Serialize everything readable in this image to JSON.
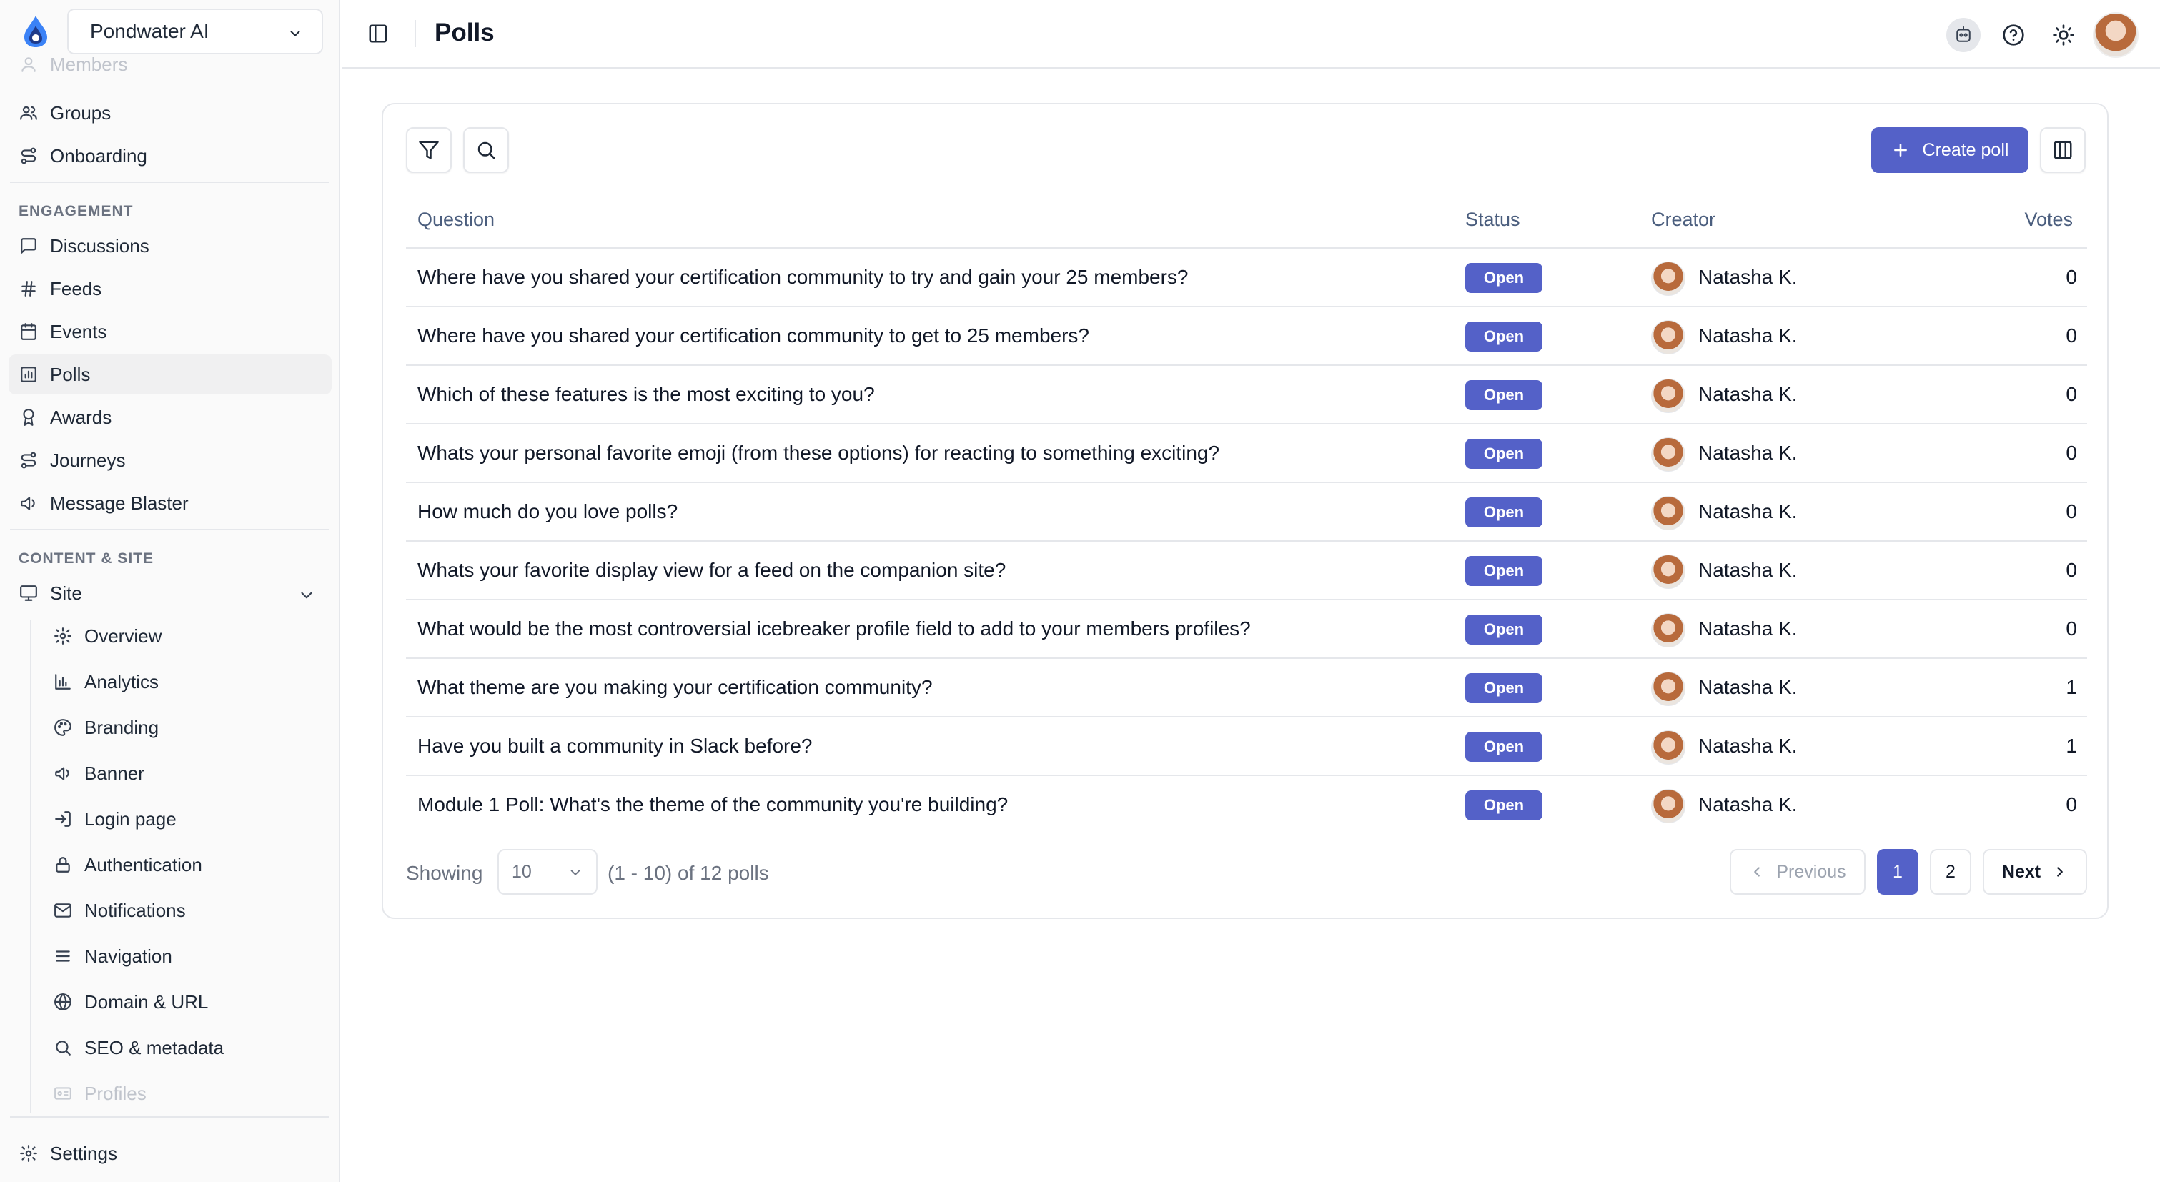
{
  "workspace": {
    "name": "Pondwater AI"
  },
  "sidebar": {
    "top_items": [
      {
        "label": "Members",
        "icon": "user-icon"
      },
      {
        "label": "Groups",
        "icon": "users-icon"
      },
      {
        "label": "Onboarding",
        "icon": "route-icon"
      }
    ],
    "engagement_label": "ENGAGEMENT",
    "engagement_items": [
      {
        "label": "Discussions",
        "icon": "message-square-icon"
      },
      {
        "label": "Feeds",
        "icon": "hash-icon"
      },
      {
        "label": "Events",
        "icon": "calendar-icon"
      },
      {
        "label": "Polls",
        "icon": "poll-icon",
        "active": true
      },
      {
        "label": "Awards",
        "icon": "award-icon"
      },
      {
        "label": "Journeys",
        "icon": "route-icon"
      },
      {
        "label": "Message Blaster",
        "icon": "megaphone-icon"
      }
    ],
    "content_label": "CONTENT & SITE",
    "site_label": "Site",
    "site_items": [
      {
        "label": "Overview",
        "icon": "gear-icon"
      },
      {
        "label": "Analytics",
        "icon": "bar-chart-icon"
      },
      {
        "label": "Branding",
        "icon": "palette-icon"
      },
      {
        "label": "Banner",
        "icon": "megaphone-icon"
      },
      {
        "label": "Login page",
        "icon": "login-icon"
      },
      {
        "label": "Authentication",
        "icon": "lock-icon"
      },
      {
        "label": "Notifications",
        "icon": "mail-icon"
      },
      {
        "label": "Navigation",
        "icon": "menu-icon"
      },
      {
        "label": "Domain & URL",
        "icon": "globe-icon"
      },
      {
        "label": "SEO & metadata",
        "icon": "search-icon"
      },
      {
        "label": "Profiles",
        "icon": "id-card-icon"
      }
    ],
    "settings_label": "Settings"
  },
  "header": {
    "title": "Polls"
  },
  "toolbar": {
    "create_label": "Create poll"
  },
  "table": {
    "columns": {
      "question": "Question",
      "status": "Status",
      "creator": "Creator",
      "votes": "Votes"
    },
    "rows": [
      {
        "question": "Where have you shared your certification community to try and gain your 25 members?",
        "status": "Open",
        "creator": "Natasha K.",
        "votes": "0"
      },
      {
        "question": "Where have you shared your certification community to get to 25 members?",
        "status": "Open",
        "creator": "Natasha K.",
        "votes": "0"
      },
      {
        "question": "Which of these features is the most exciting to you?",
        "status": "Open",
        "creator": "Natasha K.",
        "votes": "0"
      },
      {
        "question": "Whats your personal favorite emoji (from these options) for reacting to something exciting?",
        "status": "Open",
        "creator": "Natasha K.",
        "votes": "0"
      },
      {
        "question": "How much do you love polls?",
        "status": "Open",
        "creator": "Natasha K.",
        "votes": "0"
      },
      {
        "question": "Whats your favorite display view for a feed on the companion site?",
        "status": "Open",
        "creator": "Natasha K.",
        "votes": "0"
      },
      {
        "question": "What would be the most controversial icebreaker profile field to add to your members profiles?",
        "status": "Open",
        "creator": "Natasha K.",
        "votes": "0"
      },
      {
        "question": "What theme are you making your certification community?",
        "status": "Open",
        "creator": "Natasha K.",
        "votes": "1"
      },
      {
        "question": "Have you built a community in Slack before?",
        "status": "Open",
        "creator": "Natasha K.",
        "votes": "1"
      },
      {
        "question": "Module 1 Poll: What's the theme of the community you're building?",
        "status": "Open",
        "creator": "Natasha K.",
        "votes": "0"
      }
    ]
  },
  "pagination": {
    "showing_label": "Showing",
    "page_size": "10",
    "range_text": "(1 - 10) of 12 polls",
    "previous_label": "Previous",
    "next_label": "Next",
    "pages": [
      "1",
      "2"
    ],
    "current_page": "1"
  },
  "colors": {
    "accent": "#5461c8",
    "border": "#e5e7eb",
    "sidebar_bg": "#fafafa"
  }
}
